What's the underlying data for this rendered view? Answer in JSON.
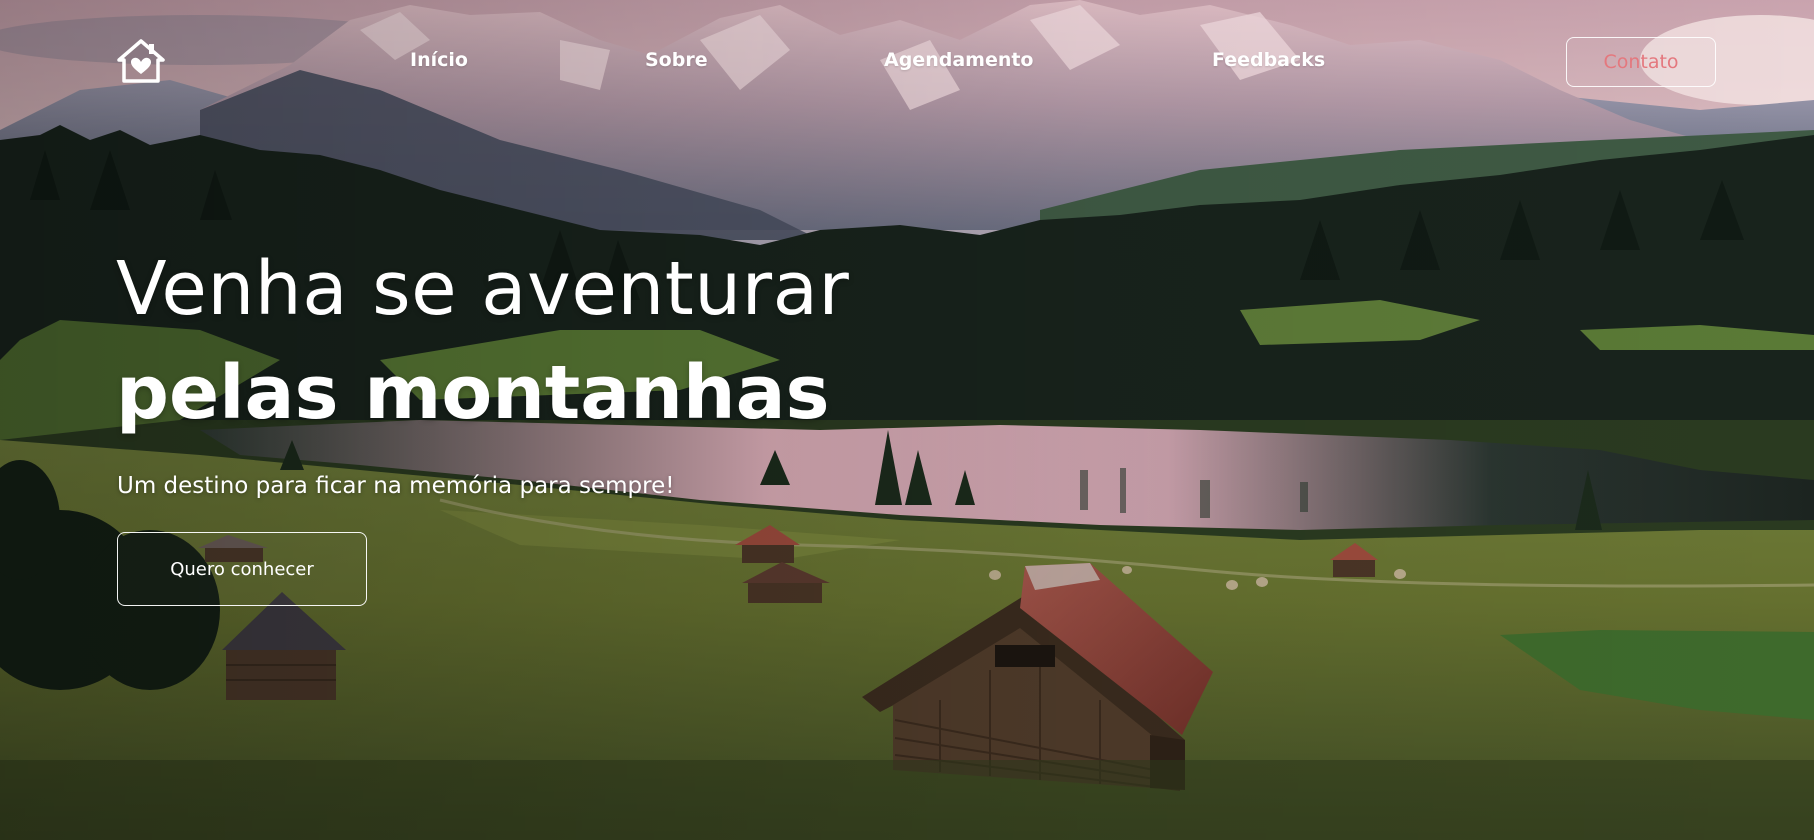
{
  "nav": {
    "logo_icon": "house-heart-icon",
    "links": [
      "Início",
      "Sobre",
      "Agendamento",
      "Feedbacks"
    ],
    "contact_label": "Contato",
    "contact_color": "#e4787e"
  },
  "hero": {
    "headline_line1": "Venha se aventurar",
    "headline_line2": "pelas montanhas",
    "subtitle": "Um destino para ficar na memória para sempre!",
    "cta_label": "Quero conhecer",
    "background_image": "mountain-lake-meadow-cabins-photo"
  }
}
